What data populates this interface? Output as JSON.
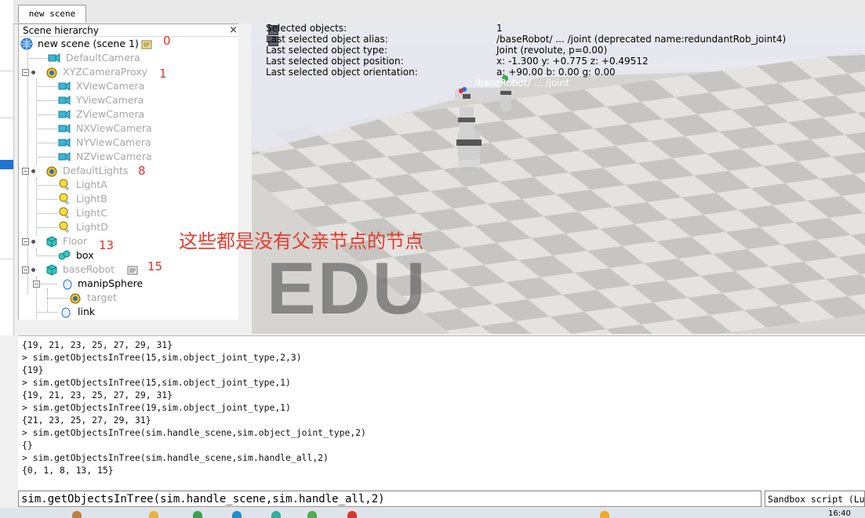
{
  "tab": {
    "label": "new scene"
  },
  "hierarchy": {
    "title": "Scene hierarchy",
    "close": "×",
    "items": [
      {
        "label": "new scene (scene 1)",
        "dim": false
      },
      {
        "label": "DefaultCamera",
        "dim": true
      },
      {
        "label": "XYZCameraProxy",
        "dim": true
      },
      {
        "label": "XViewCamera",
        "dim": true
      },
      {
        "label": "YViewCamera",
        "dim": true
      },
      {
        "label": "ZViewCamera",
        "dim": true
      },
      {
        "label": "NXViewCamera",
        "dim": true
      },
      {
        "label": "NYViewCamera",
        "dim": true
      },
      {
        "label": "NZViewCamera",
        "dim": true
      },
      {
        "label": "DefaultLights",
        "dim": true
      },
      {
        "label": "LightA",
        "dim": true
      },
      {
        "label": "LightB",
        "dim": true
      },
      {
        "label": "LightC",
        "dim": true
      },
      {
        "label": "LightD",
        "dim": true
      },
      {
        "label": "Floor",
        "dim": true
      },
      {
        "label": "box",
        "dim": false
      },
      {
        "label": "baseRobot",
        "dim": true
      },
      {
        "label": "manipSphere",
        "dim": false
      },
      {
        "label": "target",
        "dim": true
      },
      {
        "label": "link",
        "dim": false
      }
    ],
    "handles": [
      "0",
      "1",
      "8",
      "13",
      "15"
    ]
  },
  "info": {
    "rows": [
      {
        "key": "Selected objects:",
        "value": "1"
      },
      {
        "key": "Last selected object alias:",
        "value": "/baseRobot/ ... /joint    (deprecated name:redundantRob_joint4)"
      },
      {
        "key": "Last selected object type:",
        "value": "Joint (revolute, p=0.00)"
      },
      {
        "key": "Last selected object position:",
        "value": "x: -1.300    y: +0.775    z: +0.49512"
      },
      {
        "key": "Last selected object orientation:",
        "value": "a: +90.00    b: 0.00    g: 0.00"
      }
    ],
    "robot_label": "/baseRobot/ ... /joint"
  },
  "annotation": "这些都是没有父亲节点的节点",
  "watermark": "EDU",
  "console": {
    "lines": [
      "{19, 21, 23, 25, 27, 29, 31}",
      "> sim.getObjectsInTree(15,sim.object_joint_type,2,3)",
      "{19}",
      "> sim.getObjectsInTree(15,sim.object_joint_type,1)",
      "{19, 21, 23, 25, 27, 29, 31}",
      "> sim.getObjectsInTree(19,sim.object_joint_type,1)",
      "{21, 23, 25, 27, 29, 31}",
      "> sim.getObjectsInTree(sim.handle_scene,sim.object_joint_type,2)",
      "{}",
      "> sim.getObjectsInTree(sim.handle_scene,sim.handle_all,2)",
      "{0, 1, 8, 13, 15}"
    ],
    "input": "sim.getObjectsInTree(sim.handle_scene,sim.handle_all,2)",
    "script_selector": "Sandbox script (Lua)"
  },
  "taskbar": {
    "clock": "16:40"
  },
  "colors": {
    "annotation": "#e53b2f",
    "selection": "#1f73d2",
    "dim_text": "#a6a6a6"
  }
}
